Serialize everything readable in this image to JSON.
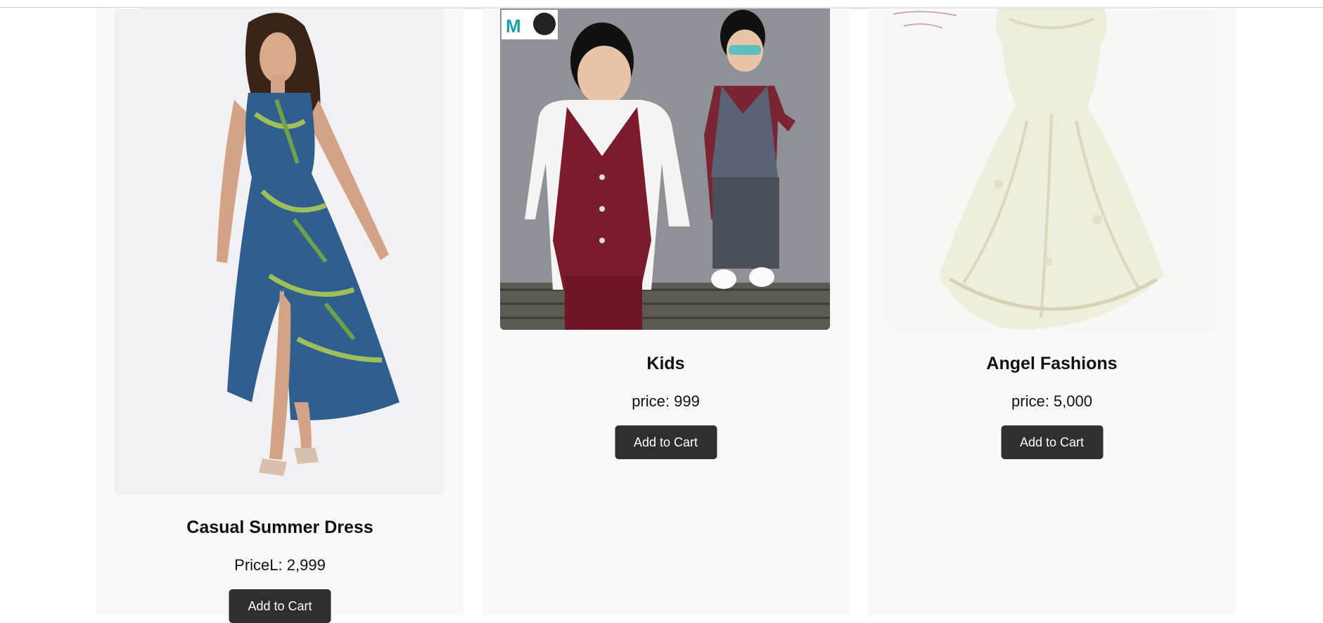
{
  "products": [
    {
      "title": "Casual Summer Dress",
      "price": "PriceL: 2,999",
      "button": "Add to Cart",
      "image": "woman-summer-dress-photo"
    },
    {
      "title": "Kids",
      "price": "price: 999",
      "button": "Add to Cart",
      "image": "kids-formal-wear-photo"
    },
    {
      "title": "Angel Fashions",
      "price": "price: 5,000",
      "button": "Add to Cart",
      "image": "cream-lace-gown-photo"
    }
  ]
}
